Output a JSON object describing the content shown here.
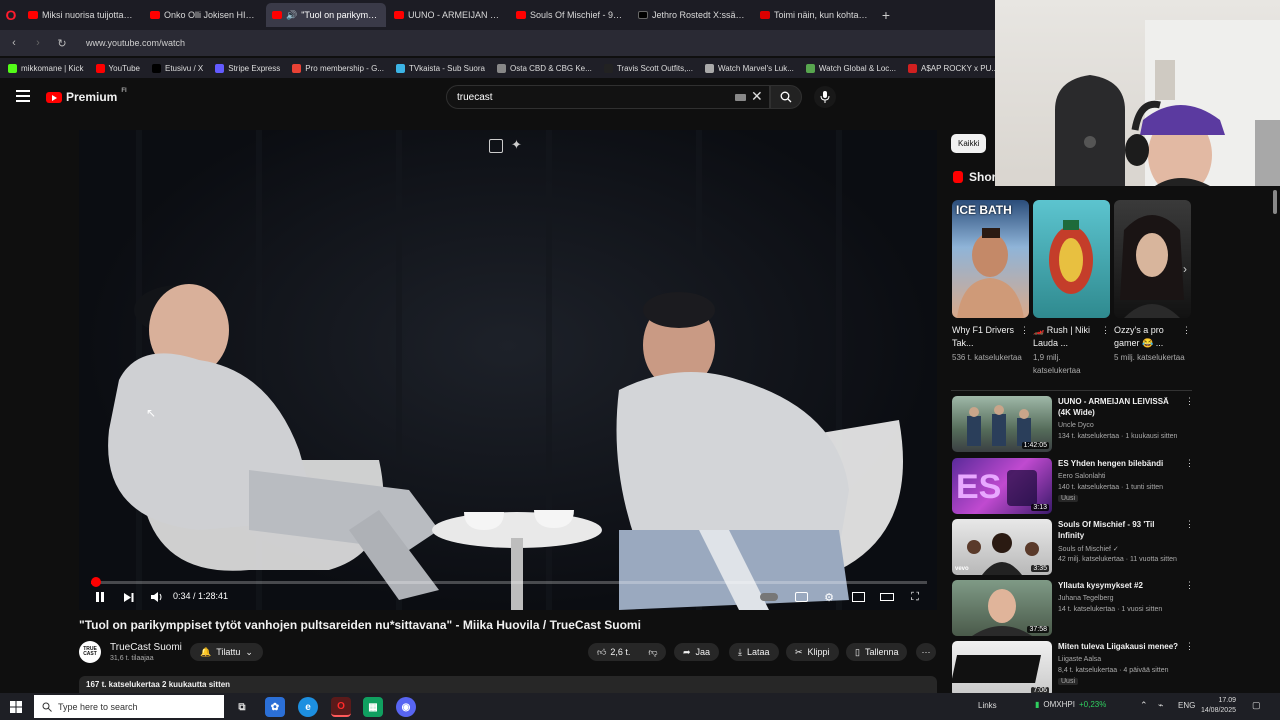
{
  "browser": {
    "tabs": [
      {
        "title": "Miksi nuorisa tuijottaa? |",
        "favicon": "youtube"
      },
      {
        "title": "Onko Olli Jokisen HIFK pe",
        "favicon": "youtube"
      },
      {
        "title": "\"Tuol on parikympp...",
        "favicon": "youtube",
        "active": true
      },
      {
        "title": "UUNO - ARMEIJAN LEIVISS",
        "favicon": "youtube"
      },
      {
        "title": "Souls Of Mischief - 93 'Til",
        "favicon": "youtube"
      },
      {
        "title": "Jethro Rostedt X:ssä: \"Peu",
        "favicon": "x"
      },
      {
        "title": "Toimi näin, kun kohtaat p",
        "favicon": "il"
      }
    ],
    "new_tab": "+",
    "url": "www.youtube.com/watch",
    "bookmarks": [
      {
        "label": "mikkomane | Kick",
        "color": "#53fc18"
      },
      {
        "label": "YouTube",
        "color": "#ff0000"
      },
      {
        "label": "Etusivu / X",
        "color": "#000000"
      },
      {
        "label": "Stripe Express",
        "color": "#635bff"
      },
      {
        "label": "Pro membership - G...",
        "color": "#e94235"
      },
      {
        "label": "TVkaista - Sub Suora",
        "color": "#3cb4e5"
      },
      {
        "label": "Osta CBD & CBG Ke...",
        "color": "#888888"
      },
      {
        "label": "Travis Scott Outfits,...",
        "color": "#222222"
      },
      {
        "label": "Watch Marvel's Luk...",
        "color": "#aaaaaa"
      },
      {
        "label": "Watch Global & Loc...",
        "color": "#58a64f"
      },
      {
        "label": "A$AP ROCKY x PU...",
        "color": "#d12020"
      }
    ]
  },
  "yt": {
    "logo_text": "Premium",
    "country": "FI",
    "search_value": "truecast",
    "video": {
      "title": "\"Tuol on parikymppiset tytöt vanhojen pultsareiden nu*sittavana\" - Miika Huovila / TrueCast Suomi",
      "time": "0:34 / 1:28:41",
      "progress": 0.0064,
      "channel_name": "TrueCast Suomi",
      "channel_avatar": "TRUE CAST",
      "subscribers": "31,6 t. tilaajaa",
      "subscribed_label": "Tilattu",
      "like_count": "2,6 t.",
      "share_label": "Jaa",
      "download_label": "Lataa",
      "clip_label": "Klippi",
      "save_label": "Tallenna",
      "more_label": "···",
      "description_meta": "167 t. katselukertaa  2 kuukautta sitten"
    },
    "chip_all": "Kaikki",
    "shorts_heading": "Shorts",
    "shorts": [
      {
        "title": "Why F1 Drivers Tak...",
        "views": "536 t. katselukertaa",
        "overlay": "ICE BATH"
      },
      {
        "title": "🏎️ Rush | Niki Lauda ...",
        "views": "1,9 milj. katselukertaa",
        "overlay": ""
      },
      {
        "title": "Ozzy's a pro gamer 😂 ...",
        "views": "5 milj. katselukertaa",
        "overlay": ""
      }
    ],
    "recommendations": [
      {
        "title": "UUNO - ARMEIJAN LEIVISSÄ (4K Wide)",
        "channel": "Uncle Dyco",
        "meta": "134 t. katselukertaa · 1 kuukausi sitten",
        "duration": "1:42:05",
        "badge": ""
      },
      {
        "title": "ES Yhden hengen bilebändi",
        "channel": "Eero Salonlahti",
        "meta": "140 t. katselukertaa · 1 tunti sitten",
        "duration": "3:13",
        "badge": "Uusi"
      },
      {
        "title": "Souls Of Mischief - 93 'Til Infinity",
        "channel": "Souls of Mischief ✓",
        "meta": "42 milj. katselukertaa · 11 vuotta sitten",
        "duration": "3:35",
        "badge": ""
      },
      {
        "title": "Yllauta kysymykset #2",
        "channel": "Juhana Tegelberg",
        "meta": "14 t. katselukertaa · 1 vuosi sitten",
        "duration": "37:58",
        "badge": ""
      },
      {
        "title": "Miten tuleva Liigakausi menee?",
        "channel": "Liigaste Aalsa",
        "meta": "8,4 t. katselukertaa · 4 päivää sitten",
        "duration": "7:06",
        "badge": "Uusi"
      }
    ]
  },
  "taskbar": {
    "search_placeholder": "Type here to search",
    "links": "Links",
    "stock_name": "OMXHPI",
    "stock_change": "+0,23%",
    "lang": "ENG",
    "time": "17.09",
    "date": "14/08/2025"
  }
}
